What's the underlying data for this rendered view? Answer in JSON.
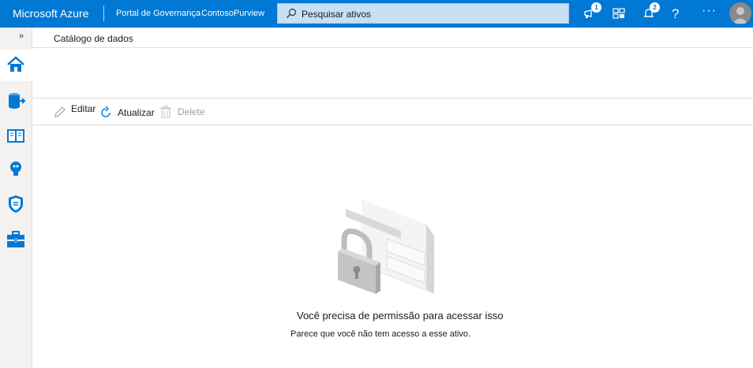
{
  "header": {
    "brand": "Microsoft Azure",
    "portal": "Portal de Governança",
    "account": "ContosoPurview",
    "search_placeholder": "Pesquisar ativos",
    "notifications_badge_1": "1",
    "notifications_badge_2": "2",
    "help": "?",
    "more": "···",
    "accent": "#0078d4"
  },
  "rail": {
    "expand": "»",
    "items": [
      "home-icon",
      "data-source-icon",
      "catalog-book-icon",
      "insights-bulb-icon",
      "policy-shield-icon",
      "management-toolbox-icon"
    ]
  },
  "page": {
    "title": "Catálogo de dados"
  },
  "toolbar": {
    "edit": "Editar",
    "refresh": "Atualizar",
    "delete": "Delete"
  },
  "message": {
    "title": "Você precisa de permissão para acessar isso",
    "subtitle": "Parece que você não tem acesso a esse ativo."
  }
}
